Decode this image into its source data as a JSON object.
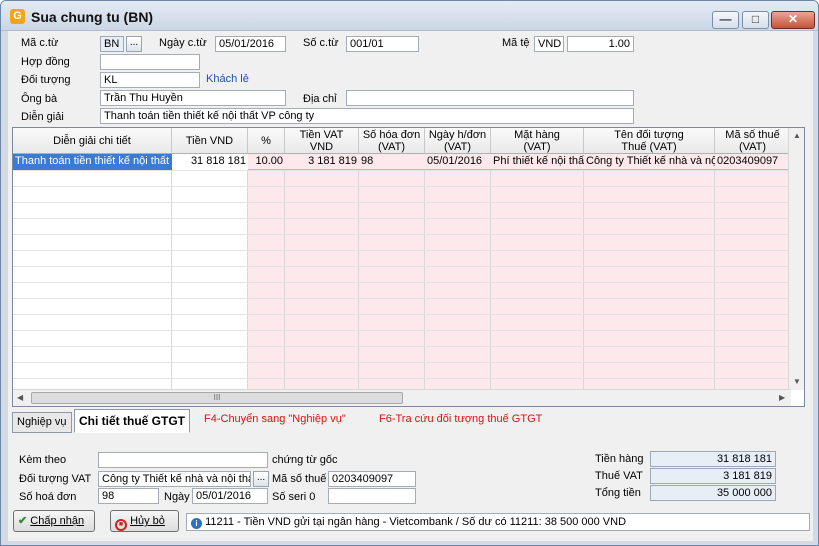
{
  "window": {
    "title": "Sua chung tu (BN)",
    "app_icon": "G",
    "minimize_glyph": "—",
    "maximize_glyph": "□",
    "close_glyph": "✕"
  },
  "header": {
    "ma_ct_label": "Mã c.từ",
    "ma_ct_value": "BN",
    "ngay_ct_label": "Ngày c.từ",
    "ngay_ct_value": "05/01/2016",
    "so_ct_label": "Số c.từ",
    "so_ct_value": "001/01",
    "ma_te_label": "Mã tệ",
    "ma_te_value": "VND",
    "ty_gia_value": "1.00",
    "hop_dong_label": "Hợp đồng",
    "hop_dong_value": "",
    "doi_tuong_label": "Đối tượng",
    "doi_tuong_value": "KL",
    "doi_tuong_name": "Khách lẻ",
    "ong_ba_label": "Ông bà",
    "ong_ba_value": "Trần Thu Huyền",
    "dia_chi_label": "Địa chỉ",
    "dia_chi_value": "",
    "dien_giai_label": "Diễn giải",
    "dien_giai_value": "Thanh toán tiền thiết kế nội thất VP công ty",
    "browse_glyph": "..."
  },
  "grid": {
    "columns": [
      "Diễn giải chi tiết",
      "Tiền VND",
      "%",
      "Tiền VAT\nVND",
      "Số hóa đơn\n(VAT)",
      "Ngày h/đơn\n(VAT)",
      "Mặt hàng\n(VAT)",
      "Tên đối tượng\nThuế (VAT)",
      "Mã số thuế\n(VAT)"
    ],
    "rows": [
      [
        "Thanh toán tiền thiết kế nội thất VP",
        "31 818 181",
        "10.00",
        "3 181 819",
        "98",
        "05/01/2016",
        "Phí thiết kế nội thất",
        "Công ty Thiết kế nhà và nội thất",
        "0203409097"
      ]
    ],
    "hscroll_grip": "III"
  },
  "tabs": {
    "nghiep_vu": "Nghiệp vụ",
    "chi_tiet_thue": "Chi tiết thuế GTGT",
    "hint_f4": "F4-Chuyển sang \"Nghiệp vụ\"",
    "hint_f6": "F6-Tra cứu đối tượng thuế GTGT"
  },
  "footer": {
    "kem_theo_label": "Kèm theo",
    "kem_theo_value": "",
    "chung_tu_goc_label": "chứng từ gốc",
    "doi_tuong_vat_label": "Đối tượng VAT",
    "doi_tuong_vat_value": "Công ty Thiết kế nhà và nội thất",
    "ma_so_thue_label": "Mã số thuế",
    "ma_so_thue_value": "0203409097",
    "so_hoa_don_label": "Số hoá đơn",
    "so_hoa_don_value": "98",
    "ngay_label": "Ngày",
    "ngay_value": "05/01/2016",
    "so_seri_label": "Số seri 0",
    "so_seri_value": "",
    "tien_hang_label": "Tiền hàng",
    "tien_hang_value": "31 818 181",
    "thue_vat_label": "Thuế VAT",
    "thue_vat_value": "3 181 819",
    "tong_tien_label": "Tổng tiền",
    "tong_tien_value": "35 000 000",
    "accept_label": "Chấp nhận",
    "cancel_label": "Hủy bỏ",
    "status_text": "11211 - Tiền VND gửi tại ngân hàng - Vietcombank / Số dư có 11211: 38 500 000 VND"
  },
  "colors": {
    "pink_cell": "#fde9ec",
    "selected_row": "#3a7bd5",
    "link": "#1f4fa8",
    "hint": "#e01010"
  }
}
